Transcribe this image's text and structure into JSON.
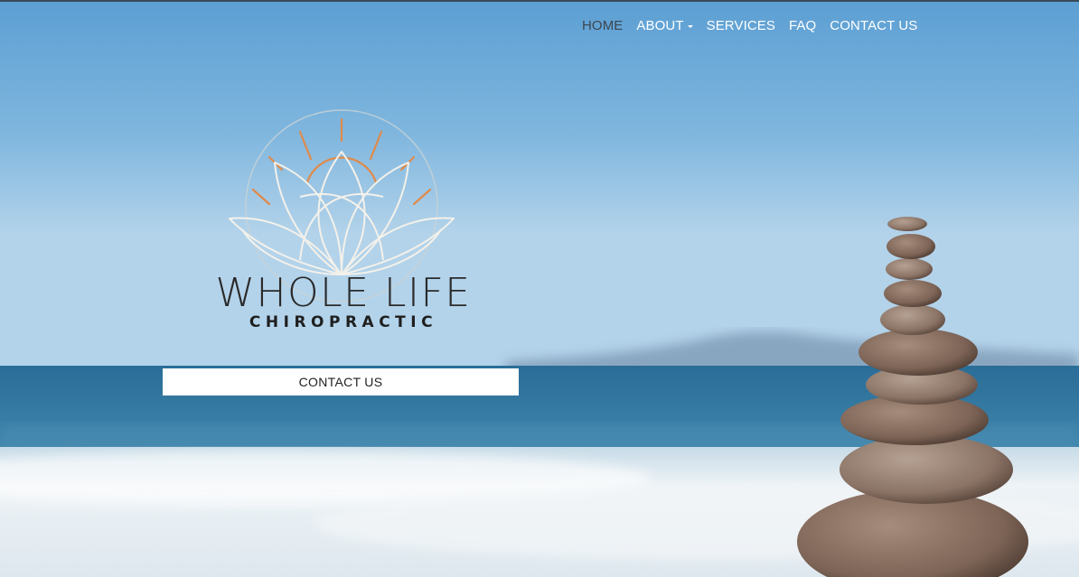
{
  "nav": {
    "items": [
      {
        "label": "HOME",
        "active": true
      },
      {
        "label": "ABOUT",
        "dropdown": true
      },
      {
        "label": "SERVICES"
      },
      {
        "label": "FAQ"
      },
      {
        "label": "CONTACT US"
      }
    ]
  },
  "logo": {
    "title": "WHOLE LIFE",
    "subtitle": "CHIROPRACTIC",
    "icon": "lotus-sun-icon"
  },
  "hero": {
    "cta_label": "CONTACT US",
    "background": "beach-stacked-stones-photo"
  },
  "colors": {
    "sky_top": "#5a9ed4",
    "sky_bottom": "#b9d6ea",
    "sea": "#2b6f9a",
    "foam": "#e9eff3",
    "sun_orange": "#e08a4a",
    "lotus_line": "#f4f1ea",
    "nav_active": "#3d4650"
  }
}
